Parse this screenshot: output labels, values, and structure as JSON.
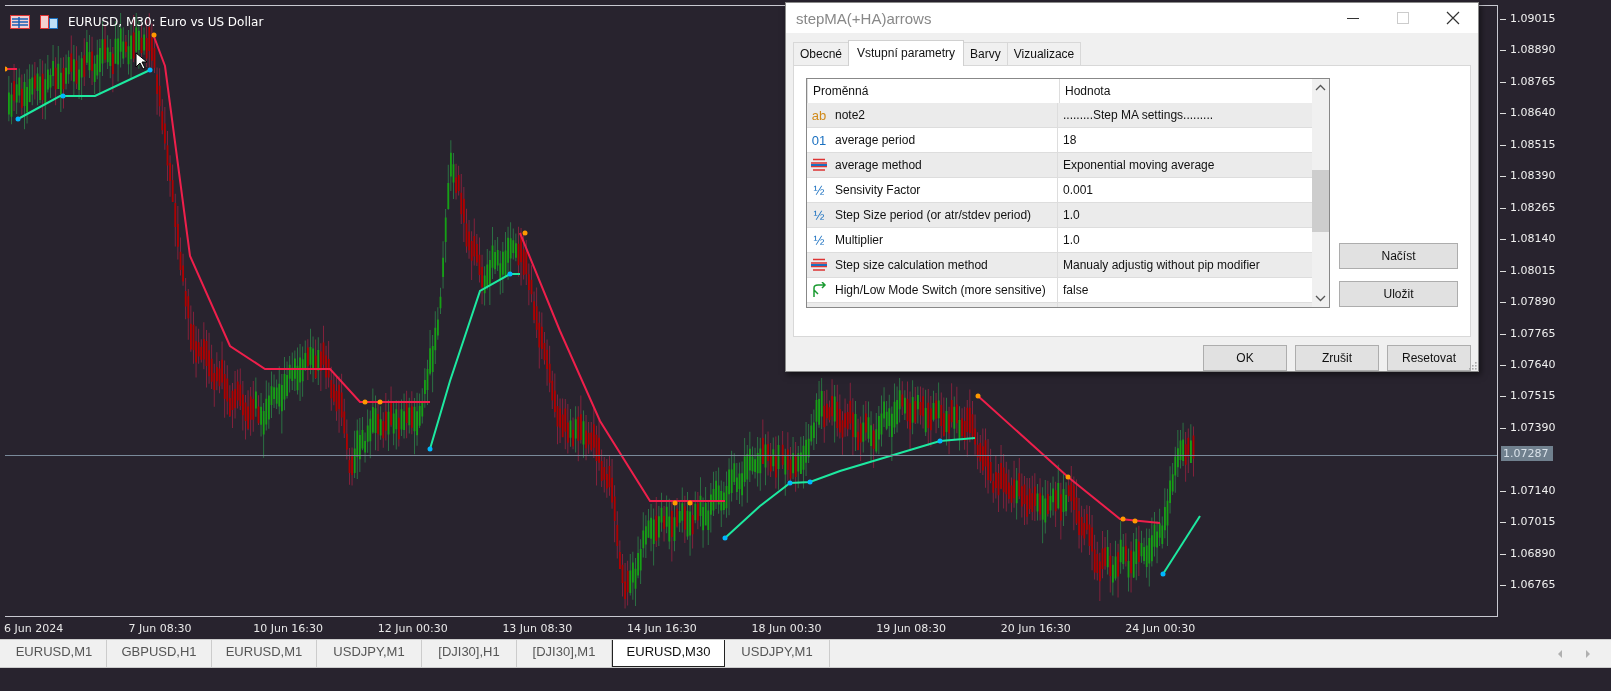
{
  "chart": {
    "title": "EURUSD, M30:  Euro vs US Dollar",
    "price_labels": [
      "1.09015",
      "1.08890",
      "1.08765",
      "1.08640",
      "1.08515",
      "1.08390",
      "1.08265",
      "1.08140",
      "1.08015",
      "1.07890",
      "1.07765",
      "1.07640",
      "1.07515",
      "1.07390",
      "1.07140",
      "1.07015",
      "1.06890",
      "1.06765"
    ],
    "current_price": "1.07287",
    "time_labels": [
      "6 Jun 2024",
      "7 Jun 08:30",
      "10 Jun 16:30",
      "12 Jun 00:30",
      "13 Jun 08:30",
      "14 Jun 16:30",
      "18 Jun 00:30",
      "19 Jun 08:30",
      "20 Jun 16:30",
      "24 Jun 00:30"
    ]
  },
  "dialog": {
    "title": "stepMA(+HA)arrows",
    "tabs": [
      {
        "label": "Obecné",
        "selected": false
      },
      {
        "label": "Vstupní parametry",
        "selected": true
      },
      {
        "label": "Barvy",
        "selected": false
      },
      {
        "label": "Vizualizace",
        "selected": false
      }
    ],
    "columns": [
      "Proměnná",
      "Hodnota"
    ],
    "rows": [
      {
        "kind": "string",
        "glyph": "ab",
        "name": "note2",
        "value": ".........Step MA settings........."
      },
      {
        "kind": "int",
        "glyph": "01",
        "name": "average period",
        "value": "18"
      },
      {
        "kind": "enum",
        "name": "average method",
        "value": "Exponential moving average"
      },
      {
        "kind": "double",
        "glyph": "½",
        "name": "Sensivity Factor",
        "value": "0.001"
      },
      {
        "kind": "double",
        "glyph": "½",
        "name": "Step Size period (or atr/stdev period)",
        "value": "1.0"
      },
      {
        "kind": "double",
        "glyph": "½",
        "name": "Multiplier",
        "value": "1.0"
      },
      {
        "kind": "enum",
        "name": "Step size calculation method",
        "value": "Manualy adjustig without pip modifier"
      },
      {
        "kind": "bool",
        "name": "High/Low Mode Switch (more sensitive)",
        "value": "false"
      }
    ],
    "side_buttons": [
      "Načíst",
      "Uložit"
    ],
    "buttons": [
      "OK",
      "Zrušit",
      "Resetovat"
    ]
  },
  "symbol_tabs": [
    {
      "label": "EURUSD,M1",
      "selected": false
    },
    {
      "label": "GBPUSD,H1",
      "selected": false
    },
    {
      "label": "EURUSD,M1",
      "selected": false
    },
    {
      "label": "USDJPY,M1",
      "selected": false
    },
    {
      "label": "[DJI30],H1",
      "selected": false
    },
    {
      "label": "[DJI30],M1",
      "selected": false
    },
    {
      "label": "EURUSD,M30",
      "selected": true
    },
    {
      "label": "USDJPY,M1",
      "selected": false
    }
  ]
}
